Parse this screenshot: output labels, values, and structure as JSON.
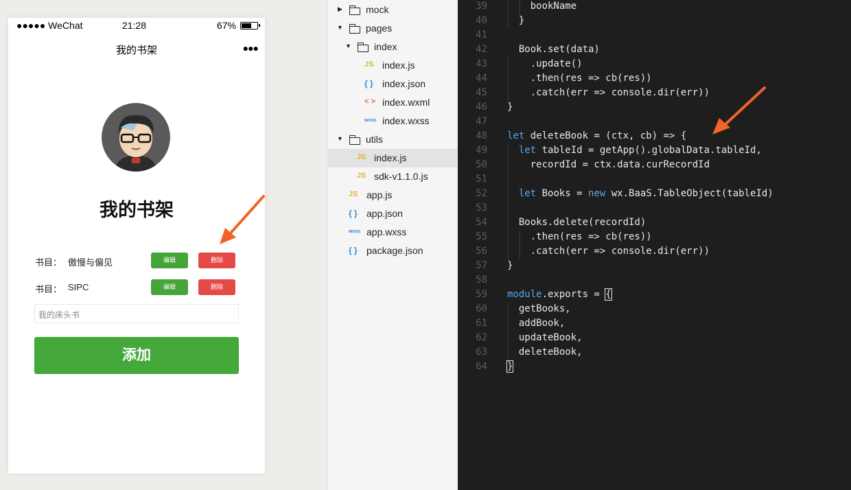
{
  "phone": {
    "status": {
      "carrier": "●●●●● WeChat",
      "time": "21:28",
      "battery": "67%",
      "battery_level": 0.67
    },
    "nav_title": "我的书架",
    "nav_more": "●●●",
    "heading": "我的书架",
    "books": [
      {
        "label": "书目：",
        "name": "傲慢与偏见",
        "edit": "编辑",
        "delete": "删除"
      },
      {
        "label": "书目：",
        "name": "SIPC",
        "edit": "编辑",
        "delete": "删除"
      }
    ],
    "input_placeholder": "我的床头书",
    "add_button": "添加"
  },
  "tree": {
    "items": [
      {
        "name": "mock",
        "type": "folder"
      },
      {
        "name": "pages",
        "type": "folder"
      },
      {
        "name": "index",
        "type": "folder"
      },
      {
        "name": "index.js",
        "type": "js",
        "icon": "JS"
      },
      {
        "name": "index.json",
        "type": "json",
        "icon": "{ }"
      },
      {
        "name": "index.wxml",
        "type": "wxml",
        "icon": "< >"
      },
      {
        "name": "index.wxss",
        "type": "wxss",
        "icon": "wxss"
      },
      {
        "name": "utils",
        "type": "folder"
      },
      {
        "name": "index.js",
        "type": "js",
        "icon": "JS"
      },
      {
        "name": "sdk-v1.1.0.js",
        "type": "js",
        "icon": "JS"
      },
      {
        "name": "app.js",
        "type": "js",
        "icon": "JS"
      },
      {
        "name": "app.json",
        "type": "json",
        "icon": "{ }"
      },
      {
        "name": "app.wxss",
        "type": "wxss",
        "icon": "wxss"
      },
      {
        "name": "package.json",
        "type": "json",
        "icon": "{ }"
      }
    ]
  },
  "editor": {
    "lines": [
      {
        "n": "39",
        "t": "    bookName"
      },
      {
        "n": "40",
        "t": "  }"
      },
      {
        "n": "41",
        "t": ""
      },
      {
        "n": "42",
        "t": "  Book.set(data)"
      },
      {
        "n": "43",
        "t": "    .update()"
      },
      {
        "n": "44",
        "t": "    .then(res => cb(res))"
      },
      {
        "n": "45",
        "t": "    .catch(err => console.dir(err))"
      },
      {
        "n": "46",
        "t": "}"
      },
      {
        "n": "47",
        "t": ""
      },
      {
        "n": "48",
        "t": "let deleteBook = (ctx, cb) => {"
      },
      {
        "n": "49",
        "t": "  let tableId = getApp().globalData.tableId,"
      },
      {
        "n": "50",
        "t": "    recordId = ctx.data.curRecordId"
      },
      {
        "n": "51",
        "t": ""
      },
      {
        "n": "52",
        "t": "  let Books = new wx.BaaS.TableObject(tableId)"
      },
      {
        "n": "53",
        "t": ""
      },
      {
        "n": "54",
        "t": "  Books.delete(recordId)"
      },
      {
        "n": "55",
        "t": "    .then(res => cb(res))"
      },
      {
        "n": "56",
        "t": "    .catch(err => console.dir(err))"
      },
      {
        "n": "57",
        "t": "}"
      },
      {
        "n": "58",
        "t": ""
      },
      {
        "n": "59",
        "t": "module.exports = {"
      },
      {
        "n": "60",
        "t": "  getBooks,"
      },
      {
        "n": "61",
        "t": "  addBook,"
      },
      {
        "n": "62",
        "t": "  updateBook,"
      },
      {
        "n": "63",
        "t": "  deleteBook,"
      },
      {
        "n": "64",
        "t": "}"
      }
    ]
  },
  "colors": {
    "edit_green": "#45a53a",
    "delete_red": "#e54a49",
    "add_green": "#45a83a",
    "keyword_blue": "#5aa6f0",
    "annotation_arrow": "#f0642a",
    "editor_bg": "#1e1e1e"
  }
}
